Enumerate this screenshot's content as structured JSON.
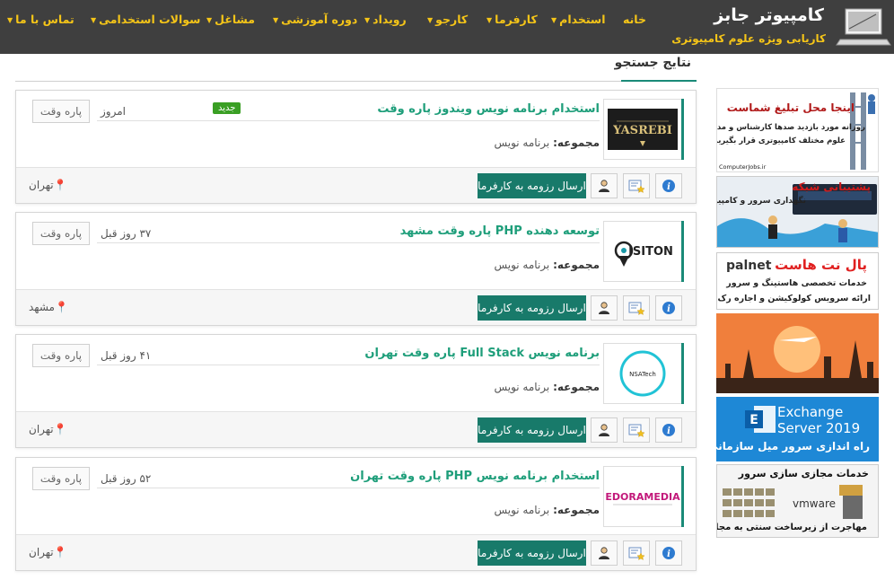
{
  "header": {
    "site_name": "کامپیوتر جابز",
    "tagline": "کاریابی ویژه علوم کامپیوتری",
    "nav": [
      {
        "label": "خانه",
        "dropdown": false
      },
      {
        "label": "استخدام",
        "dropdown": true
      },
      {
        "label": "کارفرما",
        "dropdown": true
      },
      {
        "label": "کارجو",
        "dropdown": true
      },
      {
        "label": "رویداد",
        "dropdown": true
      },
      {
        "label": "دوره آموزشی",
        "dropdown": true
      },
      {
        "label": "مشاغل",
        "dropdown": true
      },
      {
        "label": "سوالات استخدامی",
        "dropdown": true
      },
      {
        "label": "تماس با ما",
        "dropdown": true
      }
    ]
  },
  "section_title": "نتایج جستجو",
  "jobs": [
    {
      "title": "استخدام برنامه نویس ویندوز پاره وقت",
      "category_label": "مجموعه:",
      "category": "برنامه نویس",
      "date": "امروز",
      "badge_new": "جدید",
      "type": "پاره وقت",
      "location": "تهران",
      "send_label": "ارسال رزومه به کارفرما",
      "logo_text": "YASREBI"
    },
    {
      "title": "توسعه دهنده PHP پاره وقت مشهد",
      "category_label": "مجموعه:",
      "category": "برنامه نویس",
      "date": "۳۷ روز قبل",
      "type": "پاره وقت",
      "location": "مشهد",
      "send_label": "ارسال رزومه به کارفرما",
      "logo_text": "ISITON"
    },
    {
      "title": "برنامه نویس Full Stack پاره وقت تهران",
      "category_label": "مجموعه:",
      "category": "برنامه نویس",
      "date": "۴۱ روز قبل",
      "type": "پاره وقت",
      "location": "تهران",
      "send_label": "ارسال رزومه به کارفرما",
      "logo_text": "NSATech"
    },
    {
      "title": "استخدام برنامه نویس PHP پاره وقت تهران",
      "category_label": "مجموعه:",
      "category": "برنامه نویس",
      "date": "۵۲ روز قبل",
      "type": "پاره وقت",
      "location": "تهران",
      "send_label": "ارسال رزومه به کارفرما",
      "logo_text": "EDORAMEDIA"
    }
  ],
  "ads": [
    {
      "title": "اینجا محل تبلیغ شماست",
      "line1": "روزانه مورد بازدید صدها کارشناس و مدیر",
      "line2": "علوم مختلف کامپیوتری قرار بگیرید",
      "foot": "ComputerJobs.ir"
    },
    {
      "title": "پشتیبانی شبکه",
      "line1": "نگهداری سرور و کامپیوتر"
    },
    {
      "title": "پال نت هاست",
      "brand": "palnet",
      "line1": "خدمات تخصصی هاستینگ و سرور",
      "line2": "ارائه سرویس کولوکیشن و اجاره رک"
    },
    {
      "title": ""
    },
    {
      "line1": "Exchange",
      "line2": "Server 2019",
      "line3": "راه اندازی سرور میل سازمانی"
    },
    {
      "title": "خدمات مجازی سازی سرور",
      "brand": "vmware",
      "line1": "مهاجرت از زیرساخت سنتی به مجازی"
    }
  ],
  "colors": {
    "header_bg": "#3f3f3f",
    "nav_text": "#f5c518",
    "accent": "#1a8a78",
    "title_green": "#1e9e7a",
    "new_badge": "#3a9f24"
  }
}
